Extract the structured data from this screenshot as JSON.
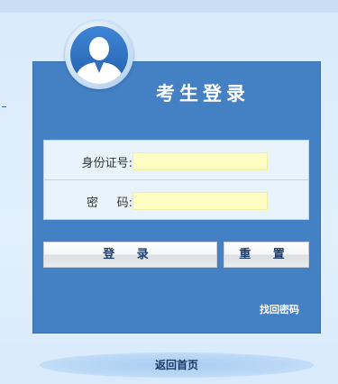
{
  "login": {
    "title": "考生登录",
    "id_label": "身份证号:",
    "id_value": "",
    "password_label": "密     码:",
    "password_value": "",
    "login_button": "登 录",
    "reset_button": "重 置",
    "forgot_link": "找回密码"
  },
  "footer": {
    "back_home": "返回首页"
  },
  "colors": {
    "panel": "#4480c4",
    "input_bg": "#fdfdc4",
    "page_bg": "#dcecfb"
  },
  "icons": {
    "avatar": "user-avatar-icon"
  }
}
